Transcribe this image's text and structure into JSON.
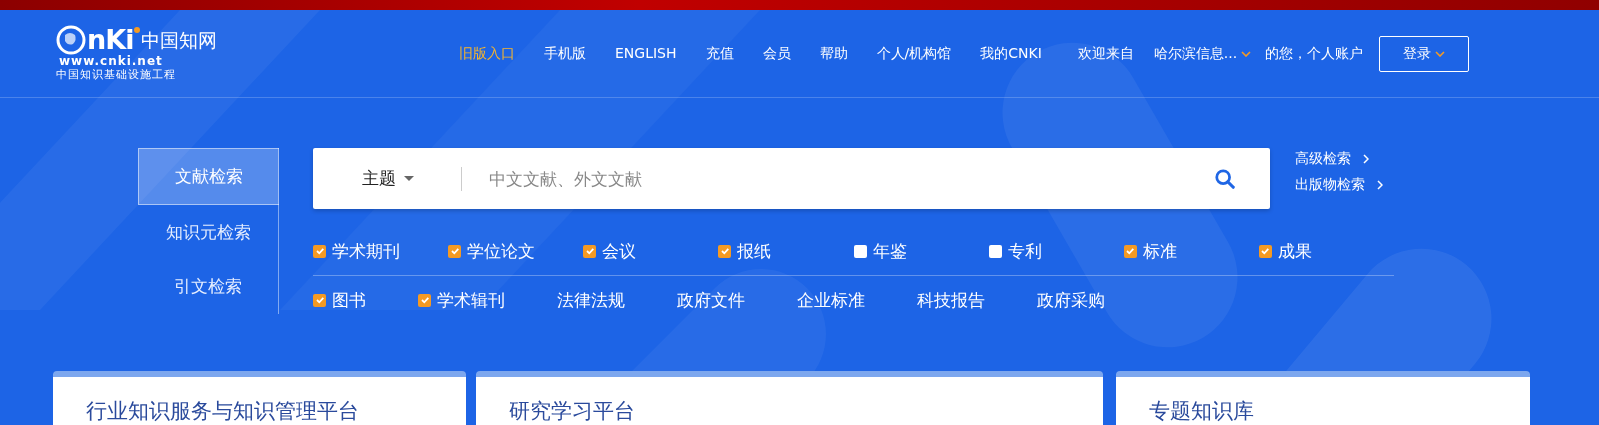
{
  "logo": {
    "brand": "nKi",
    "chinese_name": "中国知网",
    "url": "www.cnki.net",
    "slogan": "中国知识基础设施工程"
  },
  "nav": [
    {
      "label": "旧版入口",
      "highlighted": true
    },
    {
      "label": "手机版",
      "highlighted": false
    },
    {
      "label": "ENGLISH",
      "highlighted": false
    },
    {
      "label": "充值",
      "highlighted": false
    },
    {
      "label": "会员",
      "highlighted": false
    },
    {
      "label": "帮助",
      "highlighted": false
    },
    {
      "label": "个人/机构馆",
      "highlighted": false
    },
    {
      "label": "我的CNKI",
      "highlighted": false
    }
  ],
  "account": {
    "welcome": "欢迎来自",
    "institution": "哈尔滨信息...",
    "suffix": "的您，个人账户",
    "login": "登录"
  },
  "search_tabs": [
    {
      "label": "文献检索",
      "selected": true
    },
    {
      "label": "知识元检索",
      "selected": false
    },
    {
      "label": "引文检索",
      "selected": false
    }
  ],
  "search": {
    "field": "主题",
    "placeholder": "中文文献、外文文献"
  },
  "side_links": [
    "高级检索",
    "出版物检索"
  ],
  "source_rows": [
    [
      {
        "kind": "checkbox",
        "label": "学术期刊",
        "checked": true
      },
      {
        "kind": "checkbox",
        "label": "学位论文",
        "checked": true
      },
      {
        "kind": "checkbox",
        "label": "会议",
        "checked": true
      },
      {
        "kind": "checkbox",
        "label": "报纸",
        "checked": true
      },
      {
        "kind": "checkbox",
        "label": "年鉴",
        "checked": false
      },
      {
        "kind": "checkbox",
        "label": "专利",
        "checked": false
      },
      {
        "kind": "checkbox",
        "label": "标准",
        "checked": true
      },
      {
        "kind": "checkbox",
        "label": "成果",
        "checked": true
      }
    ],
    [
      {
        "kind": "checkbox",
        "label": "图书",
        "checked": true
      },
      {
        "kind": "checkbox",
        "label": "学术辑刊",
        "checked": true
      },
      {
        "kind": "link",
        "label": "法律法规"
      },
      {
        "kind": "link",
        "label": "政府文件"
      },
      {
        "kind": "link",
        "label": "企业标准"
      },
      {
        "kind": "link",
        "label": "科技报告"
      },
      {
        "kind": "link",
        "label": "政府采购"
      }
    ]
  ],
  "cards": [
    {
      "title": "行业知识服务与知识管理平台"
    },
    {
      "title": "研究学习平台"
    },
    {
      "title": "专题知识库"
    }
  ]
}
